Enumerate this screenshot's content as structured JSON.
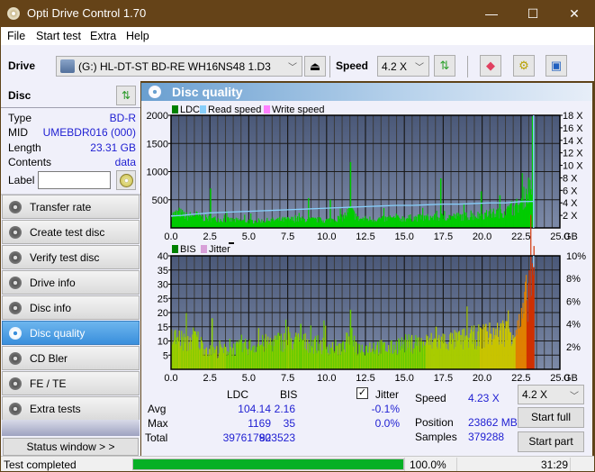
{
  "window": {
    "title": "Opti Drive Control 1.70",
    "controls": {
      "minimize": "—",
      "maximize": "☐",
      "close": "✕"
    }
  },
  "menu": [
    "File",
    "Start test",
    "Extra",
    "Help"
  ],
  "toolbar": {
    "drive_label": "Drive",
    "drive_value": "(G:)  HL-DT-ST BD-RE  WH16NS48 1.D3",
    "speed_label": "Speed",
    "speed_value": "4.2 X",
    "icons": [
      "eject-icon",
      "refresh-icon",
      "erase-icon",
      "settings-icon",
      "save-icon"
    ]
  },
  "disc": {
    "title": "Disc",
    "fields": [
      {
        "key": "Type",
        "value": "BD-R"
      },
      {
        "key": "MID",
        "value": "UMEBDR016 (000)"
      },
      {
        "key": "Length",
        "value": "23.31 GB"
      },
      {
        "key": "Contents",
        "value": "data"
      }
    ],
    "label_key": "Label",
    "label_value": ""
  },
  "nav": [
    {
      "label": "Transfer rate",
      "active": false
    },
    {
      "label": "Create test disc",
      "active": false
    },
    {
      "label": "Verify test disc",
      "active": false
    },
    {
      "label": "Drive info",
      "active": false
    },
    {
      "label": "Disc info",
      "active": false
    },
    {
      "label": "Disc quality",
      "active": true
    },
    {
      "label": "CD Bler",
      "active": false
    },
    {
      "label": "FE / TE",
      "active": false
    },
    {
      "label": "Extra tests",
      "active": false
    }
  ],
  "status_window_label": "Status window > >",
  "panel_title": "Disc quality",
  "colors": {
    "ldc": "#008000",
    "read_speed": "#87cefa",
    "write_speed": "#ff80ff",
    "bis": "#008000",
    "jitter": "#d8a0d8",
    "plot_bg_top": "#4a5878",
    "plot_bg_bottom": "#7a88a8",
    "bar_green": "#00cc00",
    "accent": "#3a8fdc",
    "progress": "#06b025"
  },
  "chart_data": [
    {
      "type": "bar",
      "title": "LDC",
      "legend": [
        "LDC",
        "Read speed",
        "Write speed"
      ],
      "xlabel": "GB",
      "x_ticks": [
        "0.0",
        "2.5",
        "5.0",
        "7.5",
        "10.0",
        "12.5",
        "15.0",
        "17.5",
        "20.0",
        "22.5",
        "25.0"
      ],
      "xlim": [
        0,
        25
      ],
      "ylim": [
        0,
        2000
      ],
      "y_ticks": [
        "500",
        "1000",
        "1500",
        "2000"
      ],
      "y2_ticks": [
        "2 X",
        "4 X",
        "6 X",
        "8 X",
        "10 X",
        "12 X",
        "14 X",
        "16 X",
        "18 X"
      ],
      "y2lim": [
        0,
        18
      ],
      "grid": true,
      "ldc_profile": {
        "x": [
          0,
          0.5,
          1,
          1.5,
          2,
          2.5,
          3,
          4,
          5,
          6,
          7,
          8,
          9,
          10,
          11,
          11.5,
          12,
          13,
          14,
          15,
          16,
          17,
          18,
          19,
          20,
          21,
          22,
          22.5,
          23,
          23.3
        ],
        "y": [
          250,
          300,
          220,
          260,
          200,
          180,
          170,
          150,
          130,
          140,
          160,
          170,
          160,
          150,
          200,
          350,
          180,
          170,
          180,
          190,
          200,
          210,
          220,
          230,
          250,
          300,
          380,
          500,
          800,
          1150
        ]
      },
      "ldc_spikes": [
        {
          "x": 2.5,
          "y": 700
        },
        {
          "x": 8.8,
          "y": 530
        },
        {
          "x": 10.2,
          "y": 500
        },
        {
          "x": 11.5,
          "y": 1169
        },
        {
          "x": 17.3,
          "y": 880
        },
        {
          "x": 19.9,
          "y": 650
        },
        {
          "x": 21.1,
          "y": 580
        }
      ],
      "read_speed": {
        "x": [
          0,
          0.7,
          1.5,
          2.5,
          3.5,
          4.5,
          5.5,
          6.5,
          7.5,
          8.5,
          9.5,
          10.5,
          11.5,
          12.5,
          13.5,
          14.5,
          15.5,
          16.5,
          17.5,
          18.5,
          19.5,
          20.5,
          21.5,
          22.5,
          23.3
        ],
        "y": [
          1.9,
          2.0,
          2.2,
          2.4,
          2.5,
          2.6,
          2.7,
          2.8,
          2.9,
          3.0,
          3.1,
          3.2,
          3.3,
          3.4,
          3.5,
          3.6,
          3.6,
          3.7,
          3.8,
          3.8,
          3.9,
          4.0,
          4.0,
          4.2,
          4.23
        ]
      },
      "end_marker_x": 23.31
    },
    {
      "type": "bar",
      "title": "BIS",
      "legend": [
        "BIS",
        "Jitter"
      ],
      "xlabel": "GB",
      "x_ticks": [
        "0.0",
        "2.5",
        "5.0",
        "7.5",
        "10.0",
        "12.5",
        "15.0",
        "17.5",
        "20.0",
        "22.5",
        "25.0"
      ],
      "xlim": [
        0,
        25
      ],
      "ylim": [
        0,
        40
      ],
      "y_ticks": [
        "5",
        "10",
        "15",
        "20",
        "25",
        "30",
        "35",
        "40"
      ],
      "y2_ticks": [
        "2%",
        "4%",
        "6%",
        "8%",
        "10%"
      ],
      "y2lim": [
        0,
        10
      ],
      "grid": true,
      "bis_profile": {
        "x": [
          0,
          0.5,
          1,
          1.5,
          2,
          2.5,
          3,
          4,
          5,
          6,
          7,
          8,
          9,
          10,
          11,
          11.5,
          12,
          13,
          14,
          15,
          16,
          17,
          18,
          19,
          20,
          21,
          22,
          22.5,
          23,
          23.3
        ],
        "y": [
          12,
          12,
          10,
          13,
          9,
          7,
          7,
          8,
          9,
          10,
          11,
          11,
          10,
          9,
          8,
          13,
          8,
          9,
          8,
          10,
          10,
          11,
          11,
          12,
          13,
          14,
          15,
          18,
          33,
          35
        ]
      },
      "bis_spikes": [
        {
          "x": 2.6,
          "y": 18
        },
        {
          "x": 7.5,
          "y": 15
        },
        {
          "x": 8.3,
          "y": 16
        },
        {
          "x": 11.5,
          "y": 21
        },
        {
          "x": 17.0,
          "y": 15
        },
        {
          "x": 20.2,
          "y": 16
        },
        {
          "x": 21.5,
          "y": 17
        }
      ],
      "end_marker_x": 23.31
    }
  ],
  "stats": {
    "headers": [
      "LDC",
      "BIS"
    ],
    "rows": [
      {
        "label": "Avg",
        "ldc": "104.14",
        "bis": "2.16",
        "jitter": "-0.1%"
      },
      {
        "label": "Max",
        "ldc": "1169",
        "bis": "35",
        "jitter": "0.0%"
      },
      {
        "label": "Total",
        "ldc": "39761790",
        "bis": "823523"
      }
    ],
    "jitter_label": "Jitter",
    "jitter_checked": true,
    "speed_label": "Speed",
    "speed_value": "4.23 X",
    "position_label": "Position",
    "position_value": "23862 MB",
    "samples_label": "Samples",
    "samples_value": "379288",
    "speed_select": "4.2 X",
    "start_full": "Start full",
    "start_part": "Start part"
  },
  "statusbar": {
    "message": "Test completed",
    "progress": 100.0,
    "progress_text": "100.0%",
    "elapsed": "31:29"
  }
}
